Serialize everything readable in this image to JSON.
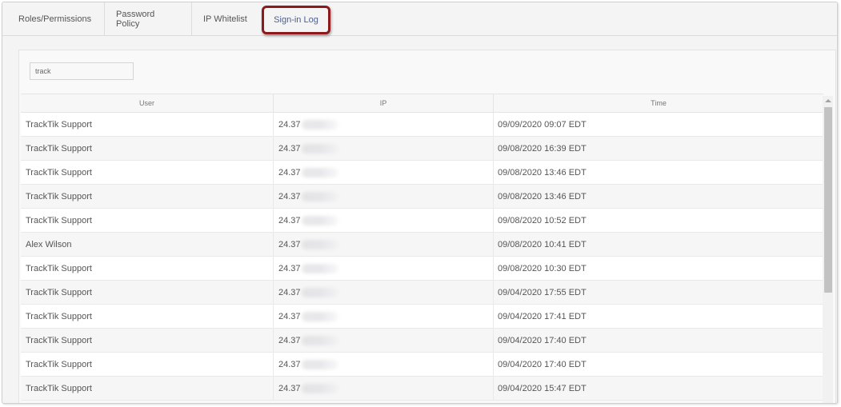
{
  "tabs": [
    {
      "label": "Roles/Permissions"
    },
    {
      "label": "Password Policy"
    },
    {
      "label": "IP Whitelist"
    },
    {
      "label": "Sign-in Log",
      "active": true
    }
  ],
  "search": {
    "value": "track"
  },
  "table": {
    "columns": [
      "User",
      "IP",
      "Time"
    ],
    "rows": [
      {
        "user": "TrackTik Support",
        "ip": "24.37",
        "time": "09/09/2020 09:07 EDT"
      },
      {
        "user": "TrackTik Support",
        "ip": "24.37",
        "time": "09/08/2020 16:39 EDT"
      },
      {
        "user": "TrackTik Support",
        "ip": "24.37",
        "time": "09/08/2020 13:46 EDT"
      },
      {
        "user": "TrackTik Support",
        "ip": "24.37",
        "time": "09/08/2020 13:46 EDT"
      },
      {
        "user": "TrackTik Support",
        "ip": "24.37",
        "time": "09/08/2020 10:52 EDT"
      },
      {
        "user": "Alex Wilson",
        "ip": "24.37",
        "time": "09/08/2020 10:41 EDT"
      },
      {
        "user": "TrackTik Support",
        "ip": "24.37",
        "time": "09/08/2020 10:30 EDT"
      },
      {
        "user": "TrackTik Support",
        "ip": "24.37",
        "time": "09/04/2020 17:55 EDT"
      },
      {
        "user": "TrackTik Support",
        "ip": "24.37",
        "time": "09/04/2020 17:41 EDT"
      },
      {
        "user": "TrackTik Support",
        "ip": "24.37",
        "time": "09/04/2020 17:40 EDT"
      },
      {
        "user": "TrackTik Support",
        "ip": "24.37",
        "time": "09/04/2020 17:40 EDT"
      },
      {
        "user": "TrackTik Support",
        "ip": "24.37",
        "time": "09/04/2020 15:47 EDT"
      }
    ]
  },
  "icons": {
    "scroll_up": "chevron-up-icon"
  },
  "colors": {
    "active_tab_border": "#8c1a1d",
    "active_tab_text": "#4c5e8a"
  }
}
